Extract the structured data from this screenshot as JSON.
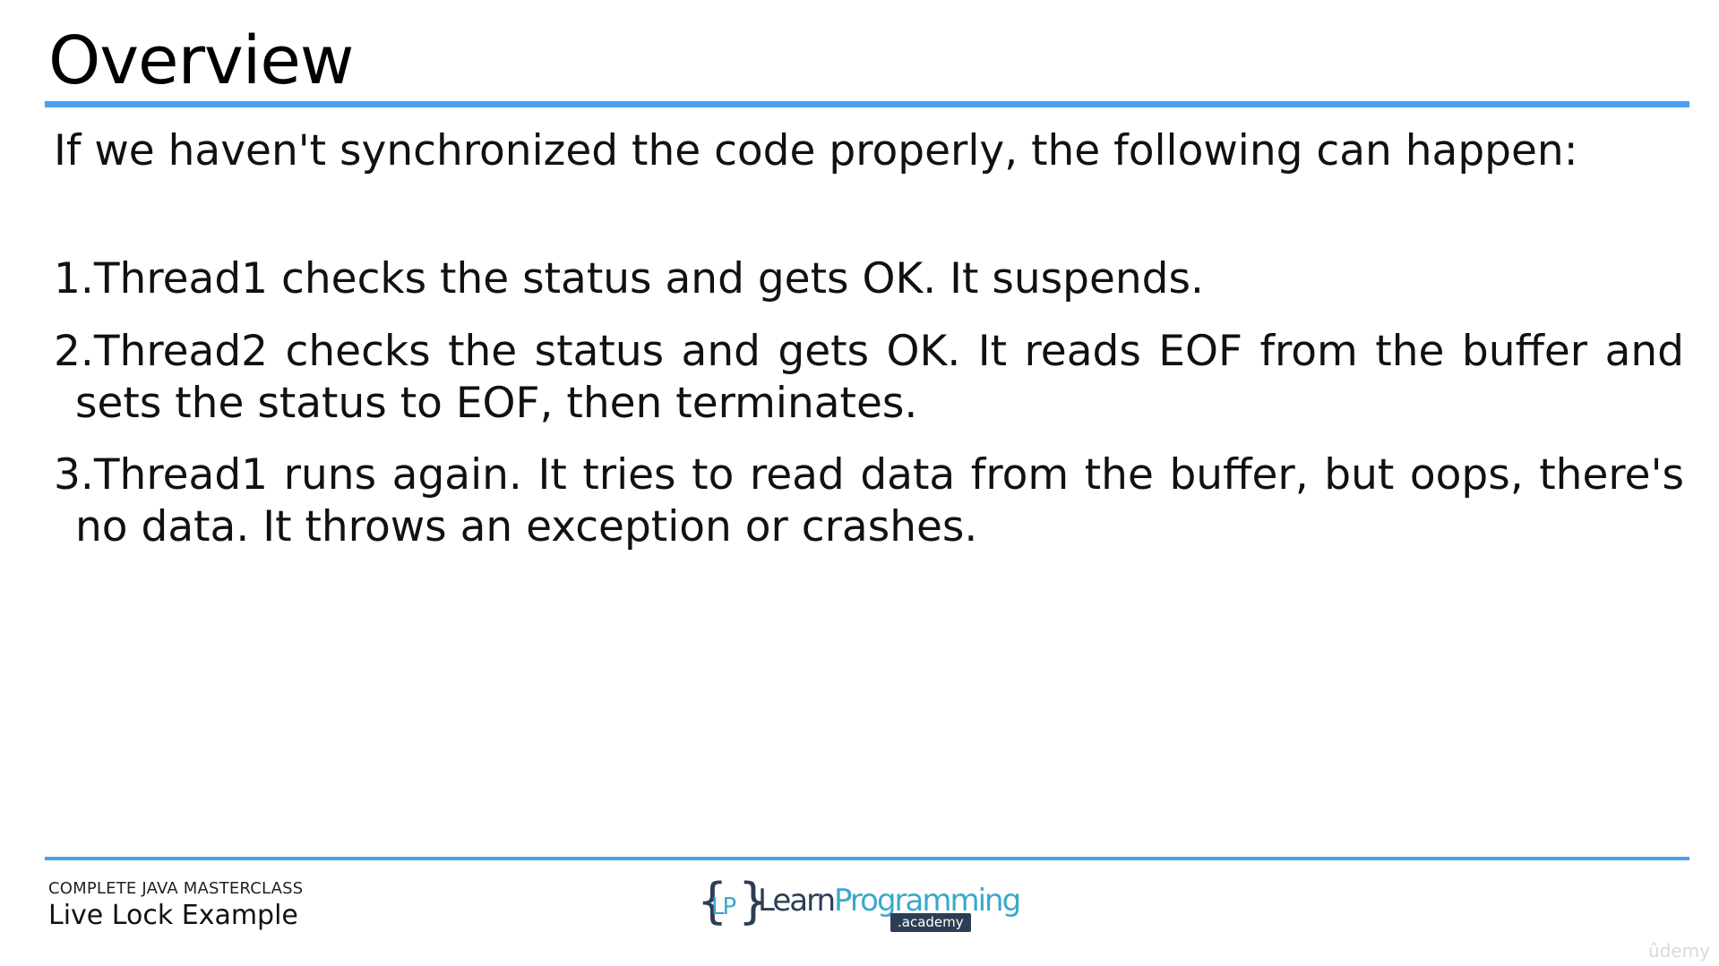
{
  "slide": {
    "title": "Overview",
    "intro": "If we haven't synchronized the code properly, the following can happen:",
    "items": [
      "1.Thread1 checks the status and gets OK. It suspends.",
      "2.Thread2 checks the status and gets OK. It reads EOF from the buffer and sets the status to EOF, then terminates.",
      "3.Thread1 runs again. It tries to read data from the buffer, but oops, there's no data. It throws an exception or crashes."
    ]
  },
  "footer": {
    "course": "COMPLETE JAVA MASTERCLASS",
    "lecture": "Live Lock Example",
    "logo": {
      "brace_left": "{",
      "mark": "LP",
      "brace_right": "}",
      "learn": "Learn",
      "programming": "Programming",
      "academy": ".academy"
    },
    "watermark": "ûdemy"
  },
  "colors": {
    "accent_rule": "#4a9ff0",
    "logo_dark": "#2c3e55",
    "logo_teal": "#3aa8c9"
  }
}
